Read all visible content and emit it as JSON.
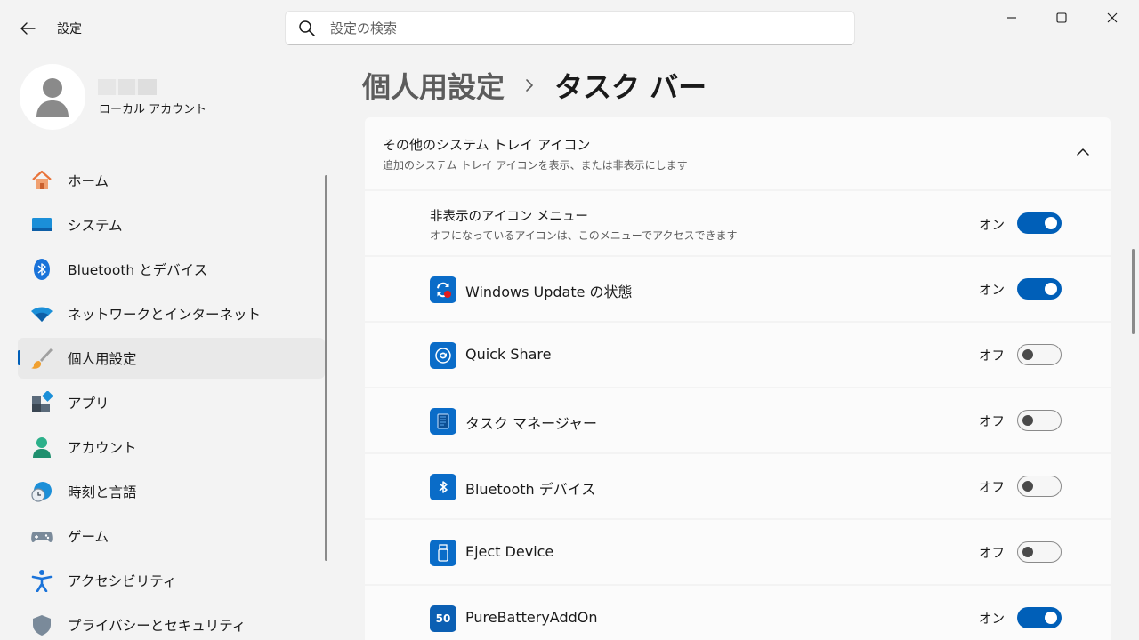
{
  "window": {
    "title": "設定",
    "controls": [
      "minimize-icon",
      "maximize-icon",
      "close-icon"
    ]
  },
  "search": {
    "placeholder": "設定の検索",
    "value": ""
  },
  "profile": {
    "account_type": "ローカル アカウント"
  },
  "nav": {
    "selected": "個人用設定",
    "items": [
      {
        "label": "ホーム",
        "icon": "home-icon"
      },
      {
        "label": "システム",
        "icon": "display-icon"
      },
      {
        "label": "Bluetooth とデバイス",
        "icon": "bluetooth-icon"
      },
      {
        "label": "ネットワークとインターネット",
        "icon": "wifi-icon"
      },
      {
        "label": "個人用設定",
        "icon": "paintbrush-icon"
      },
      {
        "label": "アプリ",
        "icon": "apps-icon"
      },
      {
        "label": "アカウント",
        "icon": "person-icon"
      },
      {
        "label": "時刻と言語",
        "icon": "clock-globe-icon"
      },
      {
        "label": "ゲーム",
        "icon": "gamepad-icon"
      },
      {
        "label": "アクセシビリティ",
        "icon": "accessibility-icon"
      },
      {
        "label": "プライバシーとセキュリティ",
        "icon": "shield-icon"
      }
    ]
  },
  "breadcrumb": {
    "parent": "個人用設定",
    "current": "タスク バー"
  },
  "section": {
    "title": "その他のシステム トレイ アイコン",
    "subtitle": "追加のシステム トレイ アイコンを表示、または非表示にします",
    "expanded": true
  },
  "hidden_menu": {
    "title": "非表示のアイコン メニュー",
    "subtitle": "オフになっているアイコンは、このメニューでアクセスできます",
    "state": "オン",
    "on": true
  },
  "tray_items": [
    {
      "label": "Windows Update の状態",
      "icon": "windows-update-icon",
      "state": "オン",
      "on": true
    },
    {
      "label": "Quick Share",
      "icon": "quick-share-icon",
      "state": "オフ",
      "on": false
    },
    {
      "label": "タスク マネージャー",
      "icon": "task-manager-icon",
      "state": "オフ",
      "on": false
    },
    {
      "label": "Bluetooth デバイス",
      "icon": "bluetooth-icon",
      "state": "オフ",
      "on": false
    },
    {
      "label": "Eject Device",
      "icon": "usb-eject-icon",
      "state": "オフ",
      "on": false
    },
    {
      "label": "PureBatteryAddOn",
      "icon": "battery-percent-icon",
      "state": "オン",
      "on": true,
      "icon_text": "50"
    }
  ],
  "colors": {
    "accent": "#005fb8",
    "tile": "#0a6cc8"
  }
}
